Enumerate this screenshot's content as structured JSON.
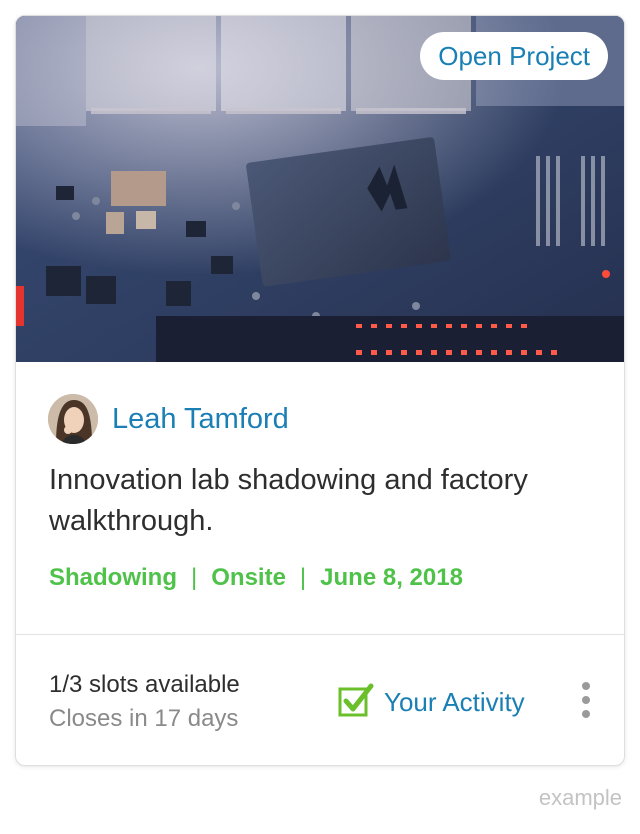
{
  "card": {
    "badge_label": "Open Project",
    "hero_image": "circuit-board-photo",
    "author": {
      "name": "Leah Tamford",
      "avatar": "user-avatar"
    },
    "description": "Innovation lab shadowing and factory walkthrough.",
    "meta": {
      "type": "Shadowing",
      "separator": "|",
      "location": "Onsite",
      "date": "June 8, 2018"
    },
    "slots": "1/3 slots available",
    "closes": "Closes in 17 days",
    "activity_label": "Your Activity",
    "activity_icon": "checkbox-checked-icon",
    "more_icon": "more-vertical-icon"
  },
  "watermark": "example",
  "colors": {
    "link_blue": "#1a7fb5",
    "meta_green": "#4fc24a",
    "check_green": "#6bbf2a",
    "text_dark": "#2e2e2e",
    "text_muted": "#8a8a8a"
  }
}
